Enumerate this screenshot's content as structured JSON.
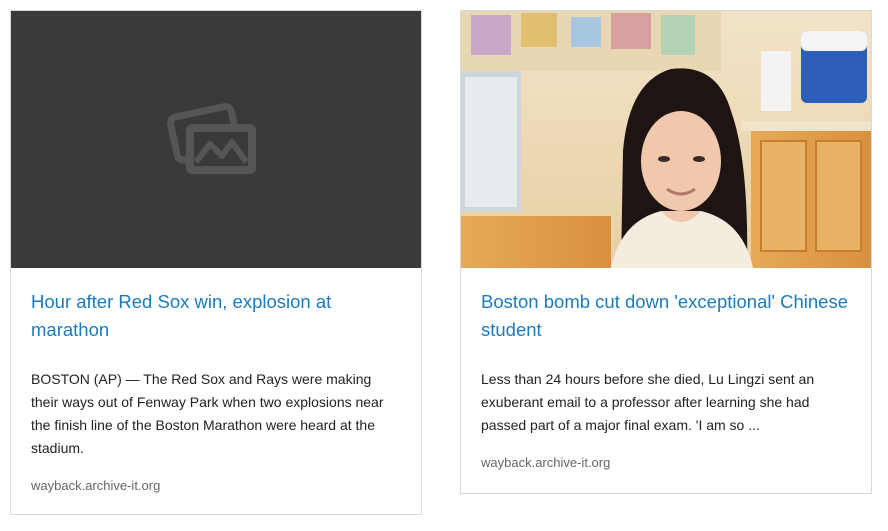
{
  "cards": [
    {
      "title": "Hour after Red Sox win, explosion at marathon",
      "description": "BOSTON (AP) — The Red Sox and Rays were making their ways out of Fenway Park when two explosions near the finish line of the Boston Marathon were heard at the stadium.",
      "source": "wayback.archive-it.org",
      "thumbnail": "placeholder-image-icon",
      "thumbnail_bg": "#3a3a3a"
    },
    {
      "title": "Boston bomb cut down 'exceptional' Chinese student",
      "description": "Less than 24 hours before she died, Lu Lingzi sent an exuberant email to a professor after learning she had passed part of a major final exam. 'I am so ...",
      "source": "wayback.archive-it.org",
      "thumbnail": "photo-of-woman"
    }
  ],
  "colors": {
    "title_link": "#1a7bbf",
    "body_text": "#222222",
    "source_text": "#666666",
    "card_border": "#d9d9d9"
  }
}
